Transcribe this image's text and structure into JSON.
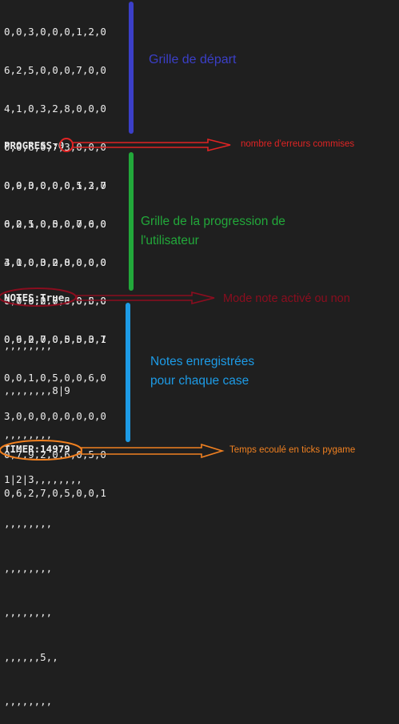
{
  "starting_grid": {
    "rows": [
      "0,0,3,0,0,0,1,2,0",
      "6,2,5,0,0,0,7,0,0",
      "4,1,0,3,2,8,0,0,0",
      "0,0,6,0,7,3,0,0,0",
      "0,9,0,0,0,0,5,3,7",
      "0,0,1,0,5,0,0,6,0",
      "3,0,0,0,0,0,0,0,0",
      "0,7,9,2,0,6,0,5,0",
      "0,6,2,7,0,5,0,0,1"
    ],
    "annotation": "Grille de départ",
    "color": "#3b3fc8"
  },
  "progress": {
    "label": "PROGRESS:",
    "value": "0",
    "annotation": "nombre d'erreurs commises",
    "color": "#e02424"
  },
  "user_grid": {
    "rows": [
      "0,0,3,0,0,0,1,2,0",
      "6,2,5,0,0,0,7,0,0",
      "4,1,0,3,2,8,0,0,0",
      "0,0,6,0,7,3,0,0,0",
      "0,9,0,0,0,0,5,3,7",
      "0,0,1,0,5,0,0,6,0",
      "3,0,0,0,0,0,0,0,0",
      "0,7,9,2,0,6,0,5,0",
      "0,6,2,7,0,5,0,0,1"
    ],
    "annotation_line1": "Grille de la progression de",
    "annotation_line2": "l'utilisateur",
    "color": "#22a83a"
  },
  "notes_status": {
    "text": "NOTES:True",
    "annotation": "Mode note activé ou non",
    "color": "#8b0d1f"
  },
  "notes": {
    "rows": [
      ",,,,,,,,",
      ",,,,,,,,8|9",
      ",,,,,,,,",
      "1|2|3,,,,,,,,",
      ",,,,,,,,",
      ",,,,,,,,",
      ",,,,,,,,",
      ",,,,,,5,,",
      ",,,,,,,,"
    ],
    "annotation_line1": "Notes enregistrées",
    "annotation_line2": "pour chaque case",
    "color": "#1d9be6"
  },
  "timer": {
    "text": "TIMER:14979",
    "annotation": "Temps ecoulé en ticks pygame",
    "color": "#f08020"
  }
}
